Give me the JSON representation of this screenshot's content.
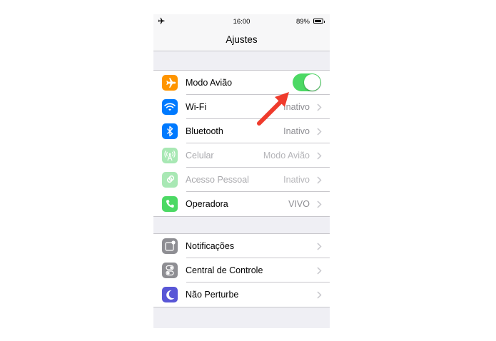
{
  "statusbar": {
    "time": "16:00",
    "battery_pct": "89%",
    "icon": "airplane-icon"
  },
  "navbar": {
    "title": "Ajustes"
  },
  "groups": [
    {
      "items": [
        {
          "label": "Modo Avião",
          "icon": "airplane-icon",
          "icon_color": "#ff9500",
          "control": "toggle",
          "toggle_on": true
        },
        {
          "label": "Wi-Fi",
          "value": "Inativo",
          "icon": "wifi-icon",
          "icon_color": "#007aff"
        },
        {
          "label": "Bluetooth",
          "value": "Inativo",
          "icon": "bluetooth-icon",
          "icon_color": "#007aff"
        },
        {
          "label": "Celular",
          "value": "Modo Avião",
          "icon": "cellular-antenna-icon",
          "icon_color": "#a8e8b4",
          "disabled": true
        },
        {
          "label": "Acesso Pessoal",
          "value": "Inativo",
          "icon": "personal-hotspot-icon",
          "icon_color": "#a8e8b4",
          "disabled": true
        },
        {
          "label": "Operadora",
          "value": "VIVO",
          "icon": "phone-icon",
          "icon_color": "#4cd964"
        }
      ]
    },
    {
      "items": [
        {
          "label": "Notificações",
          "icon": "notifications-icon",
          "icon_color": "#8e8e93"
        },
        {
          "label": "Central de Controle",
          "icon": "control-center-icon",
          "icon_color": "#8e8e93"
        },
        {
          "label": "Não Perturbe",
          "icon": "moon-icon",
          "icon_color": "#5856d6"
        }
      ]
    }
  ],
  "annotation": {
    "icon": "red-arrow-icon",
    "color": "#ef3b2c"
  }
}
